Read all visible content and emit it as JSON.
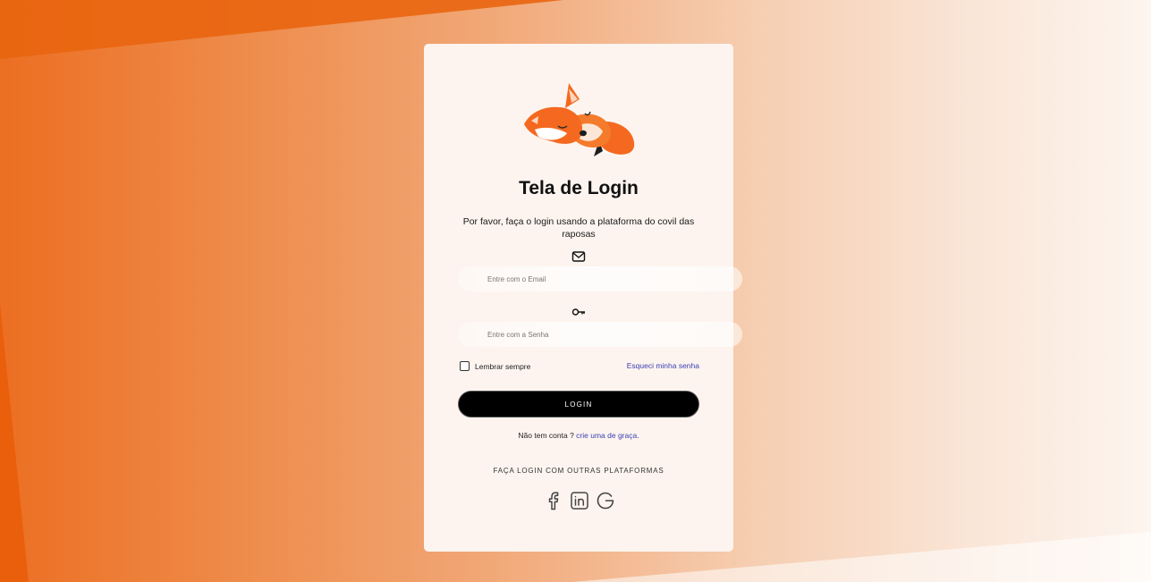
{
  "login": {
    "title": "Tela de Login",
    "subtitle": "Por favor, faça o login usando a plataforma do covil das raposas",
    "email_icon": "mail-icon",
    "email_placeholder": "Entre com o Email",
    "password_icon": "key-icon",
    "password_placeholder": "Entre com a Senha",
    "remember_label": "Lembrar sempre",
    "forgot_label": "Esqueci minha senha",
    "button_label": "LOGIN",
    "signup_prefix": "Não tem conta ?",
    "signup_link": "crie uma de graça.",
    "other_platforms_label": "FAÇA LOGIN COM OUTRAS PLATAFORMAS",
    "socials": [
      "facebook-icon",
      "linkedin-icon",
      "google-icon"
    ]
  },
  "colors": {
    "accent_orange": "#ec6f22",
    "card_background": "#fdf4ef",
    "button_background": "#000000",
    "link": "#3b3fb5"
  }
}
